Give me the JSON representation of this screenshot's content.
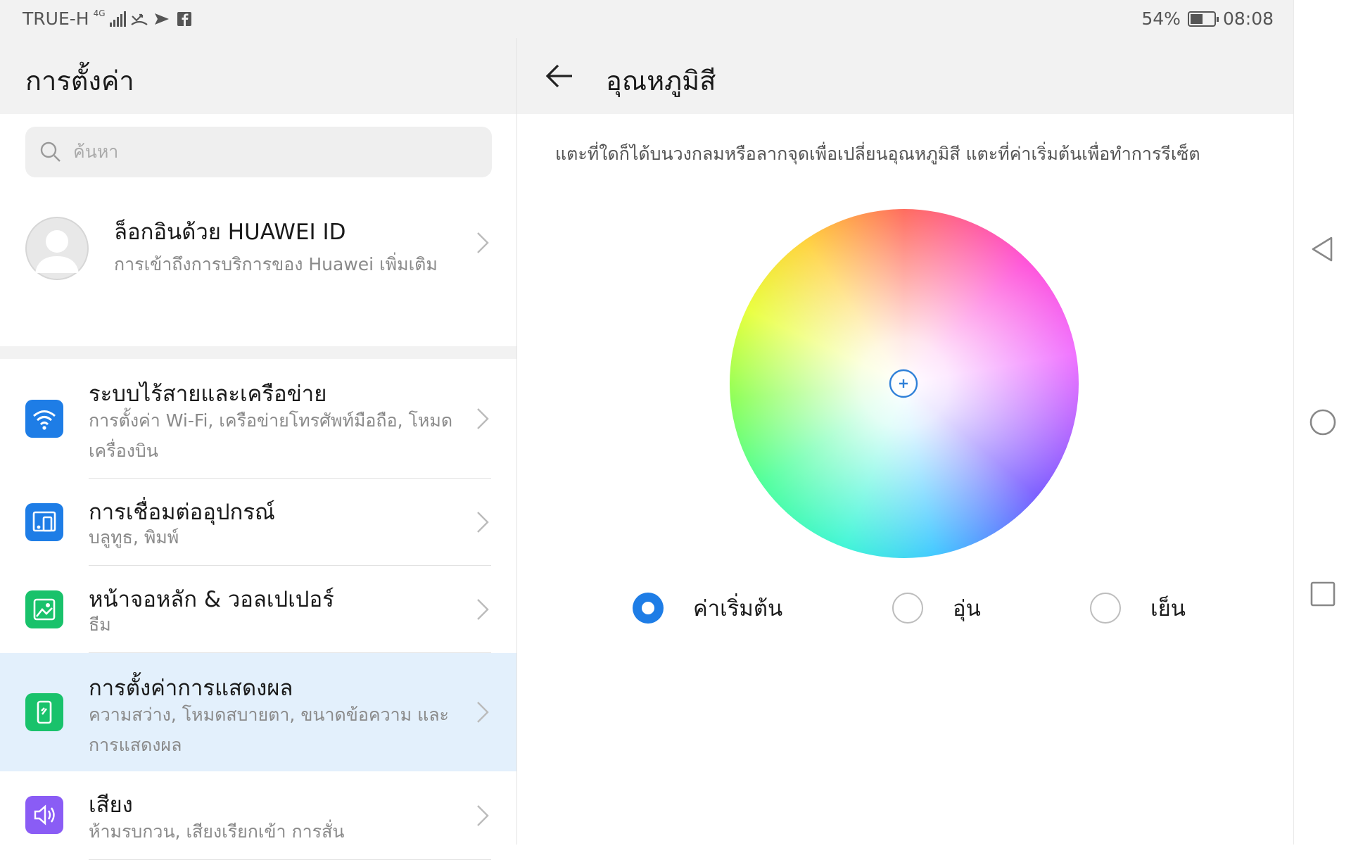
{
  "status_bar": {
    "carrier": "TRUE-H",
    "network": "4G",
    "battery_percent": "54%",
    "battery_level": 0.54,
    "time": "08:08",
    "icons": [
      "signal-icon",
      "missed-call-icon",
      "send-icon",
      "facebook-icon"
    ]
  },
  "left_panel": {
    "title": "การตั้งค่า",
    "search_placeholder": "ค้นหา",
    "account": {
      "title": "ล็อกอินด้วย HUAWEI ID",
      "subtitle": "การเข้าถึงการบริการของ Huawei เพิ่มเติม"
    },
    "items": [
      {
        "title": "ระบบไร้สายและเครือข่าย",
        "subtitle": "การตั้งค่า Wi-Fi, เครือข่ายโทรศัพท์มือถือ, โหมดเครื่องบิน",
        "icon": "wifi-icon",
        "color": "#1e7de6"
      },
      {
        "title": "การเชื่อมต่ออุปกรณ์",
        "subtitle": "บลูทูธ, พิมพ์",
        "icon": "device-connection-icon",
        "color": "#1e7de6"
      },
      {
        "title": "หน้าจอหลัก & วอลเปเปอร์",
        "subtitle": "ธีม",
        "icon": "wallpaper-icon",
        "color": "#19c26b"
      },
      {
        "title": "การตั้งค่าการแสดงผล",
        "subtitle": "ความสว่าง, โหมดสบายตา, ขนาดข้อความ และการแสดงผล",
        "icon": "display-icon",
        "color": "#19c26b",
        "selected": true
      },
      {
        "title": "เสียง",
        "subtitle": "ห้ามรบกวน, เสียงเรียกเข้า การสั่น",
        "icon": "sound-icon",
        "color": "#8a5cf5"
      }
    ]
  },
  "right_panel": {
    "title": "อุณหภูมิสี",
    "instruction": "แตะที่ใดก็ได้บนวงกลมหรือลากจุดเพื่อเปลี่ยนอุณหภูมิสี แตะที่ค่าเริ่มต้นเพื่อทำการรีเซ็ต",
    "options": [
      {
        "label": "ค่าเริ่มต้น",
        "selected": true
      },
      {
        "label": "อุ่น",
        "selected": false
      },
      {
        "label": "เย็น",
        "selected": false
      }
    ]
  },
  "nav_bar": {
    "buttons": [
      "back-triangle-icon",
      "home-circle-icon",
      "recents-square-icon"
    ]
  }
}
